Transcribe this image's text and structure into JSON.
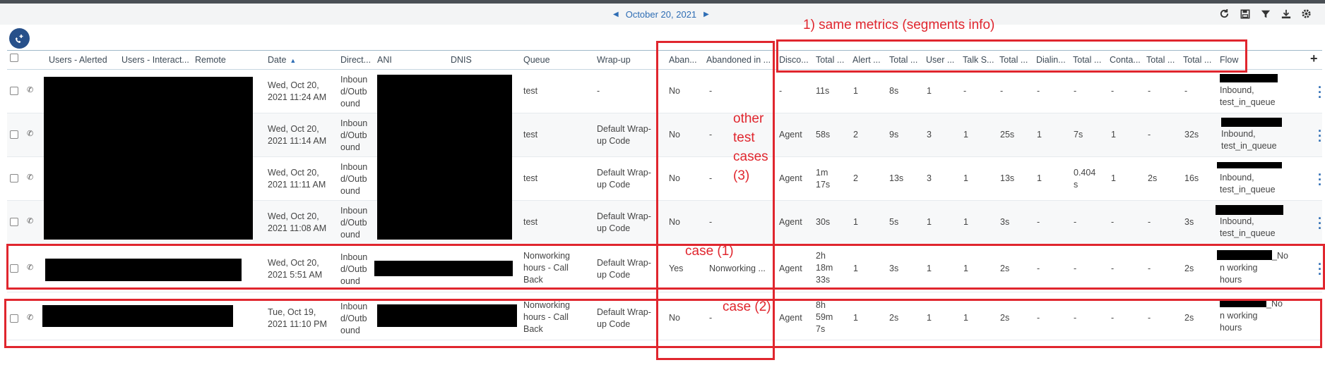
{
  "date_nav": {
    "prev_icon": "chevron-left",
    "date": "October 20, 2021",
    "next_icon": "chevron-right"
  },
  "toolbar": {
    "icons": [
      "refresh-icon",
      "save-icon",
      "filter-icon",
      "download-icon",
      "settings-icon"
    ]
  },
  "columns": [
    "Users - Alerted",
    "Users - Interact...",
    "Remote",
    "Date",
    "Direct...",
    "ANI",
    "DNIS",
    "Queue",
    "Wrap-up",
    "Aban...",
    "Abandoned in ...",
    "Disco...",
    "Total ...",
    "Alert ...",
    "Total ...",
    "User ...",
    "Talk S...",
    "Total ...",
    "Dialin...",
    "Total ...",
    "Conta...",
    "Total ...",
    "Total ...",
    "Flow"
  ],
  "sort": {
    "column": "Date",
    "direction": "ascending"
  },
  "rows": [
    {
      "date": "Wed, Oct 20,\n2021 11:24 AM",
      "direction": "Inboun\nd/Outb\nound",
      "queue": "test",
      "wrapup": "-",
      "abandoned": "No",
      "abandoned_in": "-",
      "disconnect": "-",
      "total1": "11s",
      "alert": "1",
      "total2": "8s",
      "user": "1",
      "talk": "-",
      "total3": "-",
      "dialing": "-",
      "total4": "-",
      "contact": "-",
      "total5": "-",
      "total6": "-",
      "flow": "Inbound,\ntest_in_queue"
    },
    {
      "date": "Wed, Oct 20,\n2021 11:14 AM",
      "direction": "Inboun\nd/Outb\nound",
      "queue": "test",
      "wrapup": "Default Wrap-\nup Code",
      "abandoned": "No",
      "abandoned_in": "-",
      "disconnect": "Agent",
      "total1": "58s",
      "alert": "2",
      "total2": "9s",
      "user": "3",
      "talk": "1",
      "total3": "25s",
      "dialing": "1",
      "total4": "7s",
      "contact": "1",
      "total5": "-",
      "total6": "32s",
      "flow": "Inbound,\ntest_in_queue"
    },
    {
      "date": "Wed, Oct 20,\n2021 11:11 AM",
      "direction": "Inboun\nd/Outb\nound",
      "queue": "test",
      "wrapup": "Default Wrap-\nup Code",
      "abandoned": "No",
      "abandoned_in": "-",
      "disconnect": "Agent",
      "total1": "1m\n17s",
      "alert": "2",
      "total2": "13s",
      "user": "3",
      "talk": "1",
      "total3": "13s",
      "dialing": "1",
      "total4": "0.404\ns",
      "contact": "1",
      "total5": "2s",
      "total6": "16s",
      "flow": "Inbound,\ntest_in_queue"
    },
    {
      "date": "Wed, Oct 20,\n2021 11:08 AM",
      "direction": "Inboun\nd/Outb\nound",
      "queue": "test",
      "wrapup": "Default Wrap-\nup Code",
      "abandoned": "No",
      "abandoned_in": "-",
      "disconnect": "Agent",
      "total1": "30s",
      "alert": "1",
      "total2": "5s",
      "user": "1",
      "talk": "1",
      "total3": "3s",
      "dialing": "-",
      "total4": "-",
      "contact": "-",
      "total5": "-",
      "total6": "3s",
      "flow": "Inbound,\ntest_in_queue"
    },
    {
      "date": "Wed, Oct 20,\n2021 5:51 AM",
      "direction": "Inboun\nd/Outb\nound",
      "queue": "Nonworking\nhours - Call\nBack",
      "wrapup": "Default Wrap-\nup Code",
      "abandoned": "Yes",
      "abandoned_in": "Nonworking ...",
      "disconnect": "Agent",
      "total1": "2h\n18m\n33s",
      "alert": "1",
      "total2": "3s",
      "user": "1",
      "talk": "1",
      "total3": "2s",
      "dialing": "-",
      "total4": "-",
      "contact": "-",
      "total5": "-",
      "total6": "2s",
      "flow": "_No\nn working\nhours"
    },
    {
      "date": "Tue, Oct 19,\n2021 11:10 PM",
      "direction": "Inboun\nd/Outb\nound",
      "queue": "Nonworking\nhours - Call\nBack",
      "wrapup": "Default Wrap-\nup Code",
      "abandoned": "No",
      "abandoned_in": "-",
      "disconnect": "Agent",
      "total1": "8h\n59m\n7s",
      "alert": "1",
      "total2": "2s",
      "user": "1",
      "talk": "1",
      "total3": "2s",
      "dialing": "-",
      "total4": "-",
      "contact": "-",
      "total5": "-",
      "total6": "2s",
      "flow": "_No\nn working\nhours"
    }
  ],
  "annotations": {
    "same_metrics": "1) same metrics (segments info)",
    "other_cases": "other\ntest\ncases\n(3)",
    "case1": "case (1)",
    "case2": "case (2)"
  },
  "colors": {
    "annotation_red": "#e0262e",
    "link_blue": "#2e6db4",
    "fab_navy": "#27508a"
  }
}
